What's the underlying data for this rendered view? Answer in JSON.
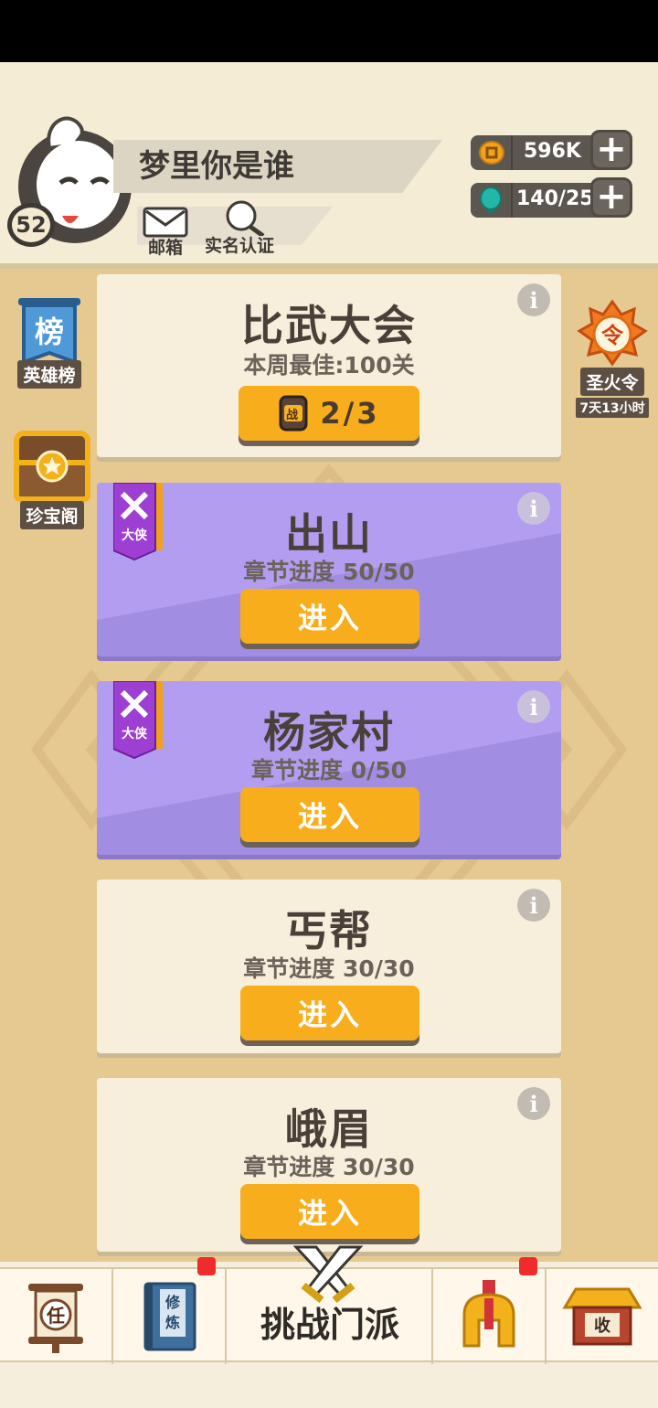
{
  "player": {
    "name": "梦里你是谁",
    "level": "52",
    "mail_label": "邮箱",
    "verify_label": "实名认证"
  },
  "resources": [
    {
      "icon": "coin-icon",
      "value": "596K"
    },
    {
      "icon": "gem-icon",
      "value": "140/25"
    }
  ],
  "side_left": {
    "rank_label": "英雄榜",
    "rank_glyph": "榜",
    "treasure_label": "珍宝阁"
  },
  "side_right": {
    "token_label": "圣火令",
    "token_glyph": "令",
    "token_timer": "7天13小时"
  },
  "tournament": {
    "title": "比武大会",
    "best": "本周最佳:100关",
    "ticket_glyph": "战",
    "attempts": "2/3"
  },
  "chapters": [
    {
      "title": "出山",
      "progress": "章节进度 50/50",
      "button": "进入",
      "tag": "大侠",
      "style": "purple"
    },
    {
      "title": "杨家村",
      "progress": "章节进度 0/50",
      "button": "进入",
      "tag": "大侠",
      "style": "purple"
    },
    {
      "title": "丐帮",
      "progress": "章节进度 30/30",
      "button": "进入",
      "style": "cream"
    },
    {
      "title": "峨眉",
      "progress": "章节进度 30/30",
      "button": "进入",
      "style": "cream"
    }
  ],
  "nav": {
    "tasks_glyph": "任",
    "training_glyph": "修炼",
    "challenge_label": "挑战门派",
    "shop_glyph": "收"
  },
  "colors": {
    "accent_orange": "#f7ad1c",
    "purple_card": "#b29df0",
    "cream_card": "#f7efdb",
    "background": "#e6c891",
    "notification": "#ef2b2b"
  }
}
